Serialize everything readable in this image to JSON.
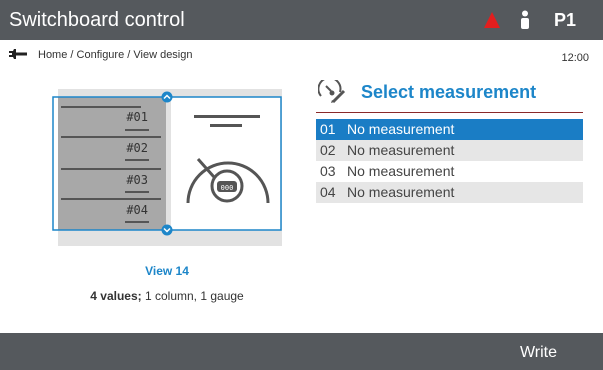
{
  "header": {
    "title": "Switchboard control",
    "panel_id": "P1",
    "alarm_color": "#e21e1e",
    "icons": [
      "warning-triangle-icon",
      "user-icon"
    ]
  },
  "breadcrumb": {
    "icon": "wrench-icon",
    "path": "Home / Configure / View design",
    "time": "12:00"
  },
  "preview": {
    "slots": [
      "#01",
      "#02",
      "#03",
      "#04"
    ],
    "gauge_display": "000",
    "view_name": "View 14",
    "summary_bold": "4 values;",
    "summary_rest": " 1 column, 1 gauge"
  },
  "measurement_panel": {
    "icon": "gauge-pen-icon",
    "title": "Select measurement",
    "accent_color": "#1d86c9",
    "selected_index": 0,
    "items": [
      {
        "num": "01",
        "label": "No measurement"
      },
      {
        "num": "02",
        "label": "No measurement"
      },
      {
        "num": "03",
        "label": "No measurement"
      },
      {
        "num": "04",
        "label": "No measurement"
      }
    ]
  },
  "footer": {
    "write_label": "Write"
  }
}
